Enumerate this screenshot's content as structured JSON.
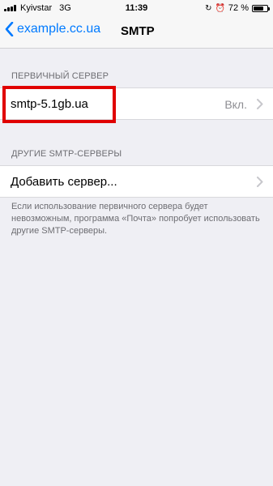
{
  "status_bar": {
    "carrier": "Kyivstar",
    "network": "3G",
    "time": "11:39",
    "battery_percent": "72 %",
    "battery_level": 0.72,
    "icons": [
      "signal-icon",
      "lock-rotation-icon",
      "alarm-icon",
      "battery-icon"
    ]
  },
  "nav": {
    "back_label": "example.cc.ua",
    "title": "SMTP",
    "accent_color": "#007aff"
  },
  "primary_server": {
    "header": "ПЕРВИЧНЫЙ СЕРВЕР",
    "name": "smtp-5.1gb.ua",
    "status": "Вкл."
  },
  "other_servers": {
    "header": "ДРУГИЕ SMTP-СЕРВЕРЫ",
    "add_label": "Добавить сервер...",
    "footer": "Если использование первичного сервера будет невозможным, программа «Почта» попробует использовать другие SMTP-серверы."
  },
  "highlight_color": "#e00000"
}
